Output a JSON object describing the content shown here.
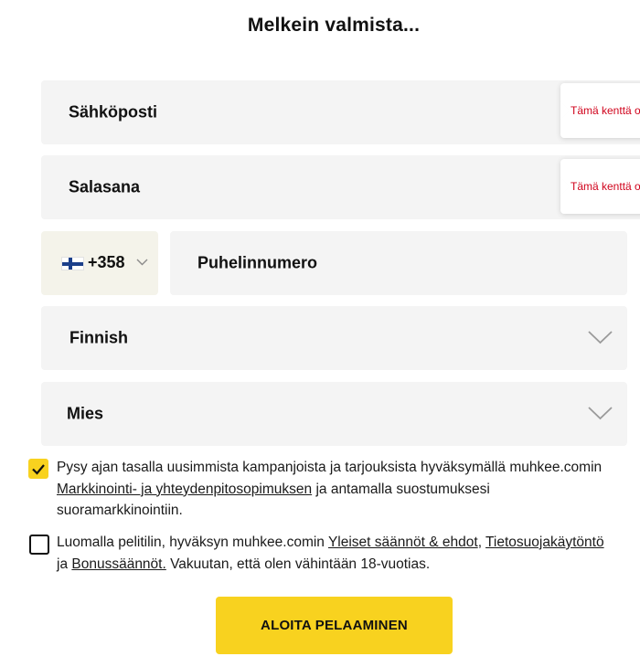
{
  "page": {
    "title": "Melkein valmista..."
  },
  "form": {
    "email": {
      "label": "Sähköposti",
      "error": "Tämä kenttä on pakollinen"
    },
    "password": {
      "label": "Salasana",
      "error": "Tämä kenttä on pakollinen"
    },
    "phone": {
      "country_code": "+358",
      "flag": "finland-flag",
      "label": "Puhelinnumero"
    },
    "language": {
      "value": "Finnish"
    },
    "gender": {
      "value": "Mies"
    }
  },
  "consents": {
    "marketing": {
      "checked": true,
      "line1": "Pysy ajan tasalla uusimmista kampanjoista ja tarjouksista hyväksymällä muhkee.comin",
      "link": "Markkinointi- ja yhteydenpitosopimuksen",
      "after_link": " ja antamalla suostumuksesi",
      "line3": "suoramarkkinointiin."
    },
    "terms": {
      "checked": false,
      "before": "Luomalla pelitilin, hyväksyn muhkee.comin ",
      "link_terms": "Yleiset säännöt & ehdot",
      "comma": ", ",
      "link_privacy": "Tietosuojakäytöntö",
      "ja": "ja ",
      "link_bonus": "Bonussäännöt.",
      "after": " Vakuutan, että olen vähintään 18-vuotias."
    }
  },
  "submit": {
    "label": "ALOITA PELAAMINEN"
  },
  "colors": {
    "accent": "#f8d21f",
    "error": "#d0021b",
    "field_bg": "#f4f4f4"
  }
}
